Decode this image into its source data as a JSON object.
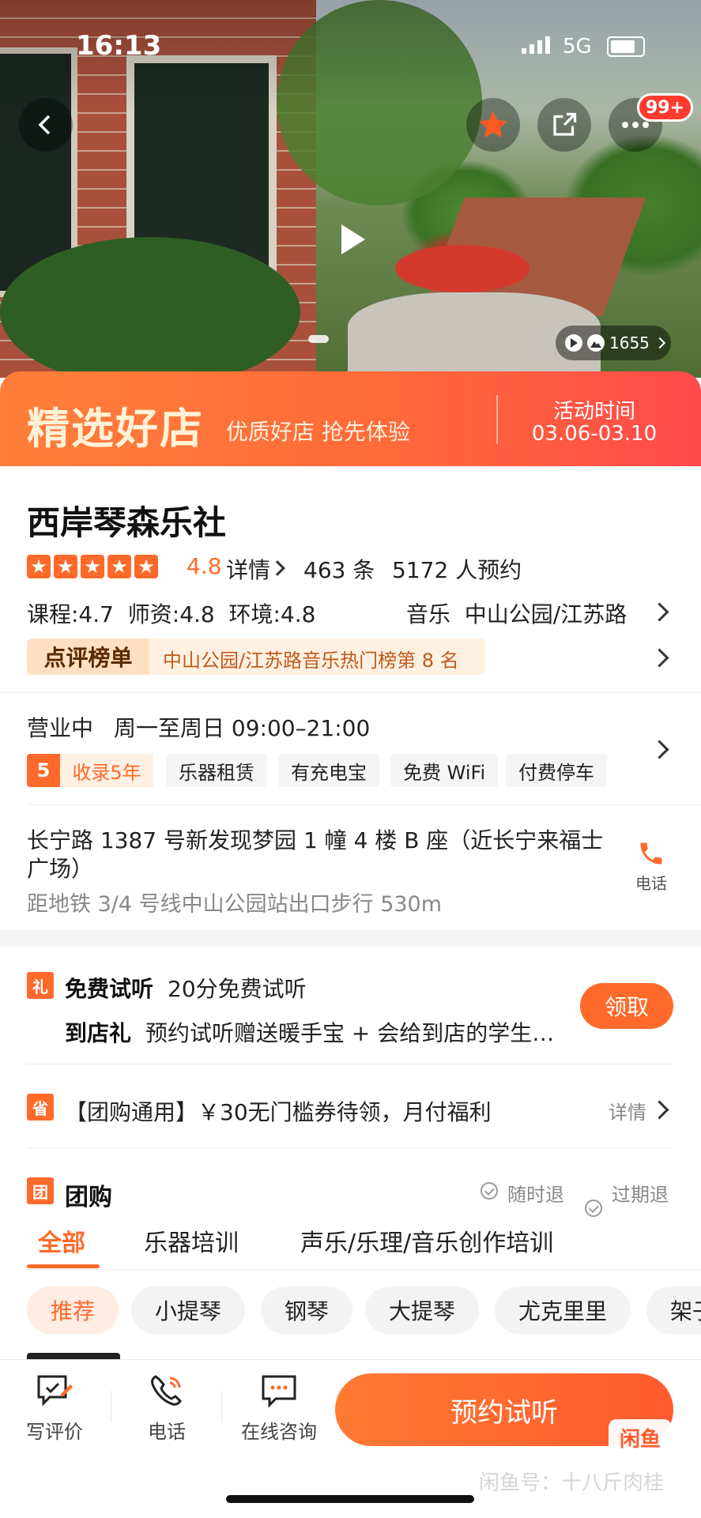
{
  "status_bar": {
    "time": "16:13",
    "network": "5G"
  },
  "hero": {
    "photo_count": "1655",
    "notification_badge": "99+"
  },
  "banner": {
    "title": "精选好店",
    "subtitle": "优质好店 抢先体验",
    "activity_label": "活动时间",
    "activity_dates": "03.06-03.10"
  },
  "shop": {
    "name": "西岸琴森乐社",
    "rating": "4.8",
    "rating_value": 4.8,
    "details_label": "详情",
    "review_count": "463 条",
    "booking_count": "5172 人预约",
    "sub_scores": "课程:4.7  师资:4.8  环境:4.8",
    "category_area": "音乐  中山公园/江苏路",
    "rank_label": "点评榜单",
    "rank_text": "中山公园/江苏路音乐热门榜第 8 名",
    "hours_status": "营业中",
    "hours_text": "周一至周日 09:00–21:00",
    "listed_num": "5",
    "listed_text": "收录5年",
    "facilities": [
      "乐器租赁",
      "有充电宝",
      "免费 WiFi",
      "付费停车"
    ],
    "address": "长宁路 1387 号新发现梦园 1 幢 4 楼 B 座（近长宁来福士广场）",
    "address_line1": "长宁路 1387 号新发现梦园 1 幢 4 楼 B 座（近长宁来福士",
    "address_line2": "广场）",
    "metro": "距地铁 3/4 号线中山公园站出口步行 530m",
    "phone_label": "电话"
  },
  "offers": {
    "gift_icon": "礼",
    "trial_title": "免费试听",
    "trial_text": "20分免费试听",
    "store_gift_title": "到店礼",
    "store_gift_text": "预约试听赠送暖手宝 + 会给到店的学生…",
    "claim_button": "领取",
    "coupon_icon": "省",
    "coupon_text": "【团购通用】￥30无门槛券待领，月付福利",
    "coupon_details": "详情"
  },
  "group_buy": {
    "icon": "团",
    "title": "团购",
    "refund_anytime": "随时退",
    "refund_expired": "过期退",
    "tabs": [
      "全部",
      "乐器培训",
      "声乐/乐理/音乐创作培训"
    ],
    "filters": [
      "推荐",
      "小提琴",
      "钢琴",
      "大提琴",
      "尤克里里",
      "架子鼓"
    ]
  },
  "bottom_bar": {
    "write_review": "写评价",
    "phone": "电话",
    "online_consult": "在线咨询",
    "book_trial": "预约试听"
  },
  "watermark": {
    "logo": "闲鱼",
    "text": "闲鱼号：十八斤肉桂"
  },
  "colors": {
    "accent": "#ff6a2a",
    "banner_start": "#ff7f3b",
    "banner_end": "#ff4a4b"
  }
}
